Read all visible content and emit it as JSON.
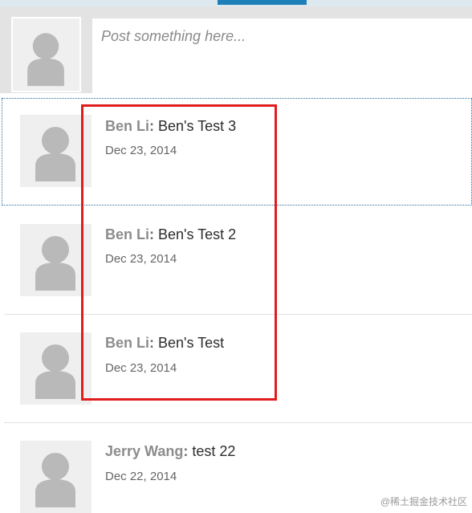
{
  "composer": {
    "placeholder": "Post something here..."
  },
  "feed": [
    {
      "author": "Ben Li",
      "message": "Ben's Test 3",
      "date": "Dec 23, 2014"
    },
    {
      "author": "Ben Li",
      "message": "Ben's Test 2",
      "date": "Dec 23, 2014"
    },
    {
      "author": "Ben Li",
      "message": "Ben's Test",
      "date": "Dec 23, 2014"
    },
    {
      "author": "Jerry Wang",
      "message": "test 22",
      "date": "Dec 22, 2014"
    }
  ],
  "watermark": "@稀土掘金技术社区",
  "colors": {
    "accent": "#1f7fb8",
    "highlight": "#e21c1c",
    "avatar_bg": "#efefef",
    "avatar_fg": "#b9b9b9"
  },
  "icons": {
    "avatar": "person-silhouette-icon"
  }
}
